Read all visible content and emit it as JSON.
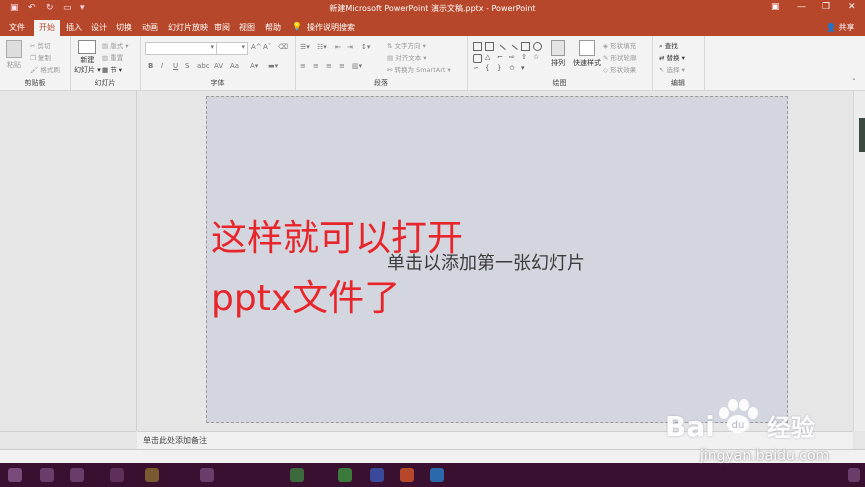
{
  "window": {
    "title": "新建Microsoft PowerPoint 演示文稿.pptx  -  PowerPoint",
    "share_label": "共享"
  },
  "tabs": [
    {
      "label": "文件"
    },
    {
      "label": "开始"
    },
    {
      "label": "插入"
    },
    {
      "label": "设计"
    },
    {
      "label": "切换"
    },
    {
      "label": "动画"
    },
    {
      "label": "幻灯片放映"
    },
    {
      "label": "审阅"
    },
    {
      "label": "视图"
    },
    {
      "label": "帮助"
    }
  ],
  "tell_me": "操作说明搜索",
  "ribbon": {
    "clipboard": {
      "label": "剪贴板",
      "paste": "粘贴",
      "cut": "剪切",
      "copy": "复制",
      "format_painter": "格式刷"
    },
    "slides": {
      "label": "幻灯片",
      "new_slide": "新建",
      "new_slide_2": "幻灯片",
      "layout": "版式",
      "reset": "重置",
      "section": "节"
    },
    "font": {
      "label": "字体",
      "bold": "B",
      "italic": "I",
      "underline": "U",
      "strike": "S",
      "spacing": "AV",
      "case": "Aa"
    },
    "paragraph": {
      "label": "段落",
      "text_direction": "文字方向",
      "align_text": "对齐文本",
      "smartart": "转换为 SmartArt"
    },
    "drawing": {
      "label": "绘图",
      "arrange": "排列",
      "quick_styles": "快速样式",
      "shape_fill": "形状填充",
      "shape_outline": "形状轮廓",
      "shape_effects": "形状效果"
    },
    "editing": {
      "label": "编辑",
      "find": "查找",
      "replace": "替换",
      "select": "选择"
    }
  },
  "slide": {
    "placeholder": "单击以添加第一张幻灯片"
  },
  "overlay": {
    "line1": "这样就可以打开",
    "line2": "pptx文件了"
  },
  "notes": {
    "placeholder": "单击此处添加备注"
  },
  "watermark": {
    "logo_left": "Bai",
    "logo_right": "经验",
    "url": "jingyan.baidu.com"
  },
  "colors": {
    "accent": "#b7472a",
    "overlay_text": "#e8252a",
    "slide_bg": "#d3d6de"
  }
}
